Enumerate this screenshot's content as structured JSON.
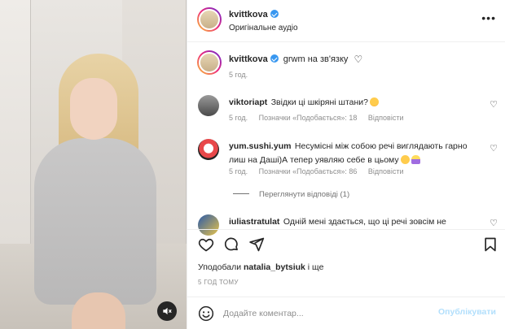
{
  "header": {
    "username": "kvittkova",
    "audio": "Оригінальне аудіо",
    "more_icon": "more-horizontal-icon"
  },
  "caption": {
    "username": "kvittkova",
    "text": "grwm на зв'язку",
    "time": "5 год."
  },
  "comments": [
    {
      "username": "viktoriapt",
      "text": "Звідки ці шкіряні штани?",
      "time": "5 год.",
      "likes": "Позначки «Подобається»: 18",
      "reply": "Відповісти"
    },
    {
      "username": "yum.sushi.yum",
      "text_line1": "Несумісні між собою речі виглядають гарно",
      "text_line2": "лиш на Даші)А тепер уявляю себе в цьому",
      "time": "5 год.",
      "likes": "Позначки «Подобається»: 86",
      "reply": "Відповісти"
    },
    {
      "username": "iuliastratulat",
      "text": "Одній мені здається, що ці речі зовсім не"
    }
  ],
  "view_replies": "Переглянути відповіді (1)",
  "likes": {
    "prefix": "Уподобали",
    "user": "natalia_bytsiuk",
    "suffix": "і ще"
  },
  "time_ago": "5 ГОД ТОМУ",
  "comment_box": {
    "placeholder": "Додайте коментар...",
    "post_label": "Опублікувати"
  },
  "colors": {
    "accent_blue": "#3897f0",
    "post_disabled": "#b2dffc",
    "text": "#262626",
    "muted": "#8e8e8e"
  }
}
